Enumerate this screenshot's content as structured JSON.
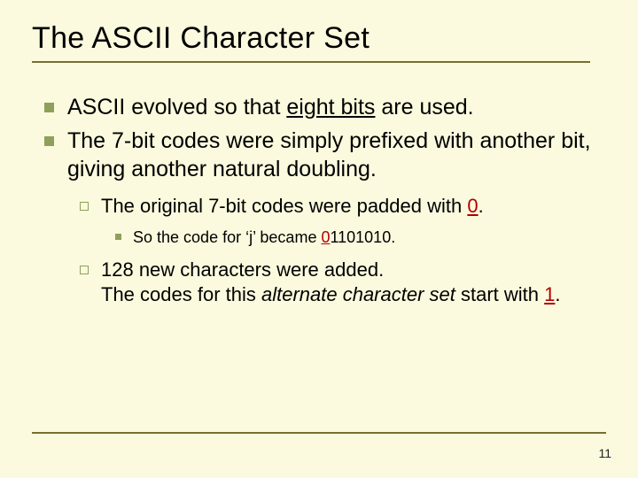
{
  "title": "The ASCII Character Set",
  "page_number": "11",
  "b1": {
    "pre": "ASCII evolved so that ",
    "em": "eight bits",
    "post": " are used."
  },
  "b2": "The 7-bit codes were simply prefixed with another bit, giving another natural doubling.",
  "b2_1": {
    "pre": "The original 7-bit codes were padded with ",
    "em": "0",
    "post": "."
  },
  "b2_1_1": {
    "pre": "So the code for ‘j’ became ",
    "em": "0",
    "post": "1101010."
  },
  "b2_2": {
    "a": "128 new characters were added.",
    "b_pre": "The codes for this ",
    "b_em": "alternate character set",
    "b_mid": " start with ",
    "b_num": "1",
    "b_post": "."
  }
}
